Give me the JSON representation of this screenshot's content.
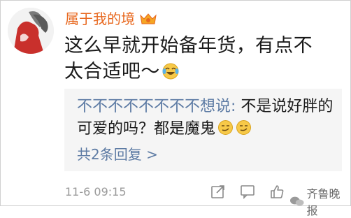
{
  "comment": {
    "username": "属于我的境",
    "text": "这么早就开始备年货，有点不太合适吧～",
    "avatar_icon": "avatar-image",
    "vip_icon": "vip-badge-icon",
    "emoji": "laughing-tears-emoji"
  },
  "reply": {
    "author": "不不不不不不不不想说:",
    "text": " 不是说好胖的可爱的吗？都是魔鬼",
    "emojis": [
      "smirk-emoji",
      "smirk-emoji"
    ],
    "count_label": "共2条回复 >"
  },
  "footer": {
    "timestamp": "11-6 09:15",
    "actions": [
      "share-icon",
      "comment-icon",
      "like-icon"
    ],
    "watermark": "齐鲁晚报"
  },
  "colors": {
    "username": "#e8681f",
    "link": "#5d7ba4",
    "reply_bg": "#f5f5f5",
    "muted": "#9a9a9a"
  }
}
